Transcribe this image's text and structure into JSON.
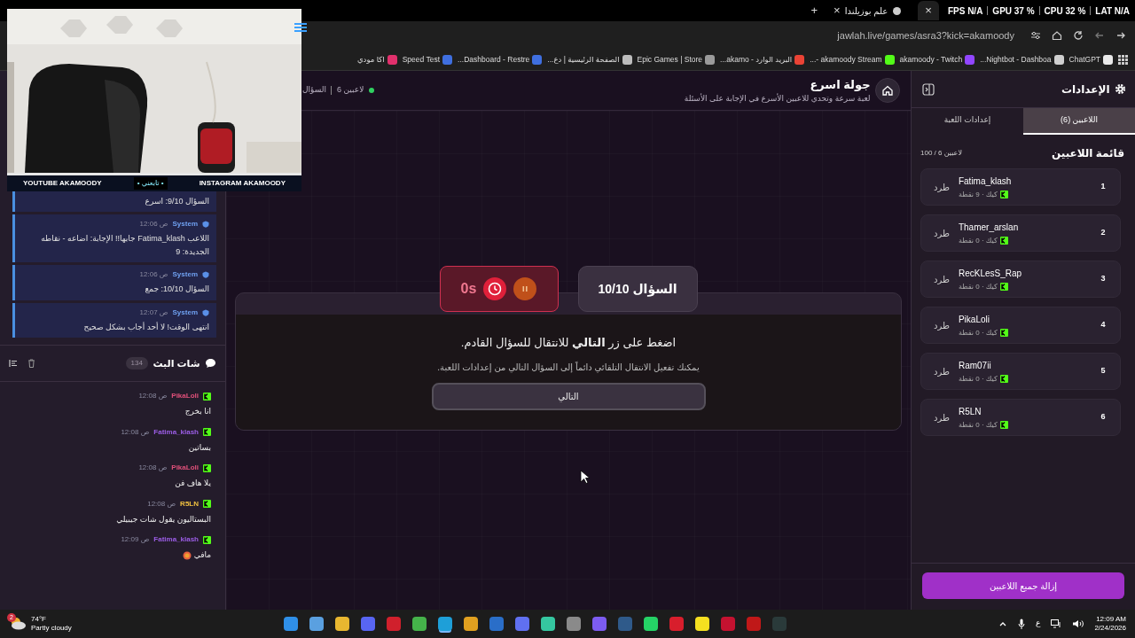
{
  "browser": {
    "tabs": [
      {
        "close": "×",
        "selected": true
      },
      {
        "title": "علم بوزيلندا",
        "close": "×",
        "selected": false
      }
    ],
    "new_tab": "+",
    "perf_overlay": [
      "LAT N/A",
      "CPU 32 %",
      "GPU 37 %",
      "FPS N/A"
    ],
    "url": "jawlah.live/games/asra3?kick=akamoody",
    "bookmarks": [
      {
        "label": "ChatGPT",
        "color": "#e8e8e8"
      },
      {
        "label": "Nightbot - Dashboa...",
        "color": "#cfcfcf"
      },
      {
        "label": "akamoody - Twitch",
        "color": "#9146ff"
      },
      {
        "label": "akamoody Stream -...",
        "color": "#53fc18"
      },
      {
        "label": "البريد الوارد - akamo...",
        "color": "#ea4335"
      },
      {
        "label": "Epic Games | Store",
        "color": "#9a9a9a"
      },
      {
        "label": "الصفحة الرئيسية | دع...",
        "color": "#bdbdbd"
      },
      {
        "label": "Dashboard - Restre...",
        "color": "#3f6fe0"
      },
      {
        "label": "Speed Test",
        "color": "#3f6fe0"
      },
      {
        "label": "اكا مودي",
        "color": "#e1306c"
      }
    ]
  },
  "stream_overlay": {
    "webcam": {
      "kind": "picture"
    },
    "banner": [
      "INSTAGRAM AKAMOODY",
      "• تابعني •",
      "YOUTUBE AKAMOODY"
    ]
  },
  "system_log": [
    {
      "text": "السؤال 9/10: اسرع"
    },
    {
      "sender": "System",
      "time": "12:06 ص",
      "text": "اللاعب Fatima_klash جابها!! الإجابة: اضاعه - نقاطه الجديدة: 9"
    },
    {
      "sender": "System",
      "time": "12:06 ص",
      "text": "السؤال 10/10: جمع"
    },
    {
      "sender": "System",
      "time": "12:07 ص",
      "text": "انتهى الوقت! لا أحد أجاب بشكل صحيح"
    }
  ],
  "chat": {
    "title": "شات البث",
    "count": "134",
    "messages": [
      {
        "user": "PikaLoli",
        "color": "#e0507a",
        "time": "12:08 ص",
        "text": "انا بخرج"
      },
      {
        "user": "Fatima_klash",
        "color": "#9b5de5",
        "time": "12:08 ص",
        "text": "بساتين"
      },
      {
        "user": "PikaLoli",
        "color": "#e0507a",
        "time": "12:08 ص",
        "text": "يلا هاف فن"
      },
      {
        "user": "R5LN",
        "color": "#f0c040",
        "time": "12:08 ص",
        "text": "البستاليون يقول شات جيبيلي"
      },
      {
        "user": "Fatima_klash",
        "color": "#9b5de5",
        "time": "12:09 ص",
        "text": "مافي",
        "emoji": true
      }
    ]
  },
  "game": {
    "title": "جولة اسرع",
    "subtitle": "لعبة سرعة وتحدي للاعبين الأسرع في الإجابة على الأسئلة",
    "players_online": "6 لاعبين",
    "question_label": "السؤال",
    "question": "السؤال 10/10",
    "timer": "0s",
    "prompt": "اضغط على زر **التالي** للانتقال للسؤال القادم.",
    "hint": "يمكنك تفعيل الانتقال التلقائي دائماً إلى السؤال التالي من إعدادات اللعبة.",
    "next_button": "التالي"
  },
  "settings": {
    "title": "الإعدادات",
    "tabs": [
      {
        "label": "اللاعبين (6)",
        "selected": true
      },
      {
        "label": "إعدادات اللعبة",
        "selected": false
      }
    ],
    "list_title": "قائمة اللاعبين",
    "capacity": "100 / 6 لاعبين",
    "players": [
      {
        "rank": "1",
        "name": "Fatima_klash",
        "meta": "كيك · 9 نقطة",
        "action": "طرد"
      },
      {
        "rank": "2",
        "name": "Thamer_arslan",
        "meta": "كيك · 0 نقطة",
        "action": "طرد"
      },
      {
        "rank": "3",
        "name": "RecKLesS_Rap",
        "meta": "كيك · 0 نقطة",
        "action": "طرد"
      },
      {
        "rank": "4",
        "name": "PikaLoli",
        "meta": "كيك · 0 نقطة",
        "action": "طرد"
      },
      {
        "rank": "5",
        "name": "Ram07ii",
        "meta": "كيك · 0 نقطة",
        "action": "طرد"
      },
      {
        "rank": "6",
        "name": "R5LN",
        "meta": "كيك · 0 نقطة",
        "action": "طرد"
      }
    ],
    "remove_all": "إزالة جميع اللاعبين"
  },
  "taskbar": {
    "weather_badge": "2",
    "temperature": "74°F",
    "condition": "Partly cloudy",
    "apps": [
      {
        "color": "#2f8fe8",
        "selected": false
      },
      {
        "color": "#5aa0e0",
        "selected": false
      },
      {
        "color": "#e8b730",
        "selected": false
      },
      {
        "color": "#5865f2",
        "selected": false
      },
      {
        "color": "#d0202c",
        "selected": false
      },
      {
        "color": "#45b34a",
        "selected": false
      },
      {
        "color": "#1e9fd8",
        "selected": true
      },
      {
        "color": "#e0a020",
        "selected": false
      },
      {
        "color": "#2a6ec8",
        "selected": false
      },
      {
        "color": "#6070f0",
        "selected": false
      },
      {
        "color": "#35c7a0",
        "selected": false
      },
      {
        "color": "#8a8a8a",
        "selected": false
      },
      {
        "color": "#7c5cf0",
        "selected": false
      },
      {
        "color": "#2f5a8a",
        "selected": false
      },
      {
        "color": "#25d366",
        "selected": false
      },
      {
        "color": "#d81e2c",
        "selected": false
      },
      {
        "color": "#f5e020",
        "selected": false
      },
      {
        "color": "#c41230",
        "selected": false
      },
      {
        "color": "#c01818",
        "selected": false
      },
      {
        "color": "#2a3a3a",
        "selected": false
      }
    ],
    "language": "ع",
    "time": "12:09 AM",
    "date": "2/24/2026"
  }
}
